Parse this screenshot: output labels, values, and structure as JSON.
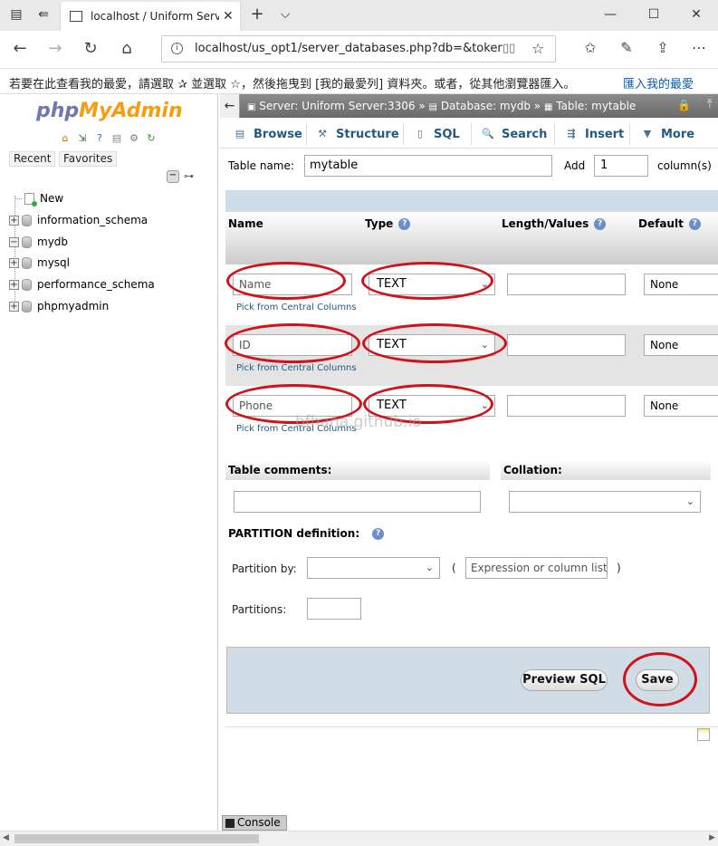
{
  "browser": {
    "tab_title": "localhost / Uniform Serv",
    "url": "localhost/us_opt1/server_databases.php?db=&token=",
    "favorites_message": "若要在此查看我的最愛，請選取 ✰ 並選取 ☆，然後拖曳到 [我的最愛列] 資料夾。或者，從其他瀏覽器匯入。",
    "favorites_import_link": "匯入我的最愛"
  },
  "sidebar": {
    "logo_php": "php",
    "logo_myadmin": "MyAdmin",
    "tab_recent": "Recent",
    "tab_favorites": "Favorites",
    "tree": [
      {
        "label": "New"
      },
      {
        "label": "information_schema"
      },
      {
        "label": "mydb"
      },
      {
        "label": "mysql"
      },
      {
        "label": "performance_schema"
      },
      {
        "label": "phpmyadmin"
      }
    ]
  },
  "breadcrumb": {
    "server": "Server: Uniform Server:3306",
    "sep": "»",
    "database": "Database: mydb",
    "table": "Table: mytable"
  },
  "menu": {
    "browse": "Browse",
    "structure": "Structure",
    "sql": "SQL",
    "search": "Search",
    "insert": "Insert",
    "more": "More"
  },
  "form": {
    "table_name_label": "Table name:",
    "table_name_value": "mytable",
    "add_label": "Add",
    "add_value": "1",
    "columns_label": "column(s)",
    "headers": {
      "name": "Name",
      "type": "Type",
      "length": "Length/Values",
      "default": "Default"
    },
    "pick_link": "Pick from Central Columns",
    "fields": [
      {
        "name": "Name",
        "type": "TEXT",
        "default": "None"
      },
      {
        "name": "ID",
        "type": "TEXT",
        "default": "None"
      },
      {
        "name": "Phone",
        "type": "TEXT",
        "default": "None"
      }
    ],
    "table_comments_label": "Table comments:",
    "collation_label": "Collation:",
    "partition_label": "PARTITION definition:",
    "partition_by_label": "Partition by:",
    "paren_open": "(",
    "paren_close": ")",
    "expression_placeholder": "Expression or column list",
    "partitions_label": "Partitions:",
    "preview_sql": "Preview SQL",
    "save": "Save"
  },
  "console_label": "Console",
  "watermark": "bfhana.github.io"
}
